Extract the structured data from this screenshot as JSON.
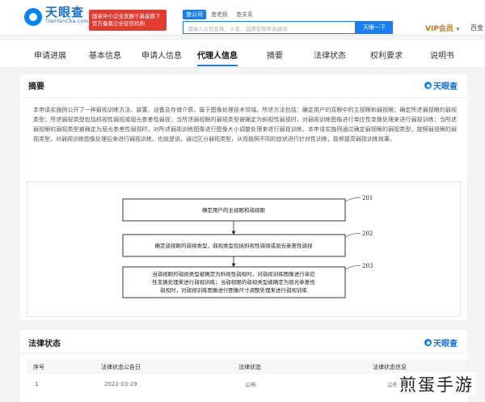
{
  "header": {
    "logo_cn": "天眼查",
    "logo_en": "TianYanCha.com",
    "promo": "国家中小企业发展子基金旗下\n官方备案企业征信机构",
    "search_tabs": [
      "查公司",
      "查老板",
      "查关系"
    ],
    "search_placeholder": "请输入公司名称、人名、品牌名称等关键词",
    "search_button": "天眼一下",
    "vip": "VIP会员",
    "baijin": "百金"
  },
  "tabs": [
    "申请进展",
    "基本信息",
    "申请人信息",
    "代理人信息",
    "摘要",
    "法律状态",
    "权利要求",
    "说明书"
  ],
  "abstract": {
    "title": "摘要",
    "watermark": "天眼查",
    "text": "本申请实施例公开了一种弱视训练方法、装置、设备及存储介质，属于图像处理技术领域。所述方法包括：确定用户的双眼中的主视眼和弱视眼；确定所述弱视眼的弱视类型；所述弱视类型包括斜视性弱视或屈光参差性弱视；当所述弱视眼的弱视类型被确定为斜视性弱视时，对弱视训练图像进行单应性变换处理来进行弱视训练；当所述弱视眼的弱视类型被确定为屈光参差性弱视时，对所述弱视训练图像进行图像大小调整处理来进行弱视训练。本申请实施例通过确定弱视眼的弱视类型，按照弱视眼的弱视类型，对弱视训练图像处理后来进行弱视训练。也就是说，通过区分弱视类型，从而按照不同的症状进行针对性训练，能够提高弱视训练效果。",
    "flow": [
      {
        "num": "201",
        "text": "确定用户的主视眼和弱视眼"
      },
      {
        "num": "202",
        "text": "确定弱视眼的弱视类型，弱视类型包括斜视性弱视或屈光参差性弱视"
      },
      {
        "num": "203",
        "lines": [
          "当弱视眼的弱视类型被确定为斜视性弱视时，对弱视训练图像进行单应",
          "性变换处理来进行弱视训练；当弱视眼的弱视类型被确定为屈光参差性",
          "弱视时，对弱视训练图像进行图像尺寸调整处理来进行弱视训练"
        ]
      }
    ]
  },
  "legal": {
    "title": "法律状态",
    "watermark": "天眼查",
    "columns": [
      "序号",
      "法律状态公告日",
      "法律状态",
      "法律状态信息"
    ],
    "rows": [
      [
        "1",
        "2022-03-29",
        "公布",
        "公布"
      ]
    ]
  },
  "corner_watermark": "煎蛋手游",
  "colors": {
    "accent": "#1a7ef2",
    "promo": "#e23b30",
    "vip": "#c8791a"
  }
}
